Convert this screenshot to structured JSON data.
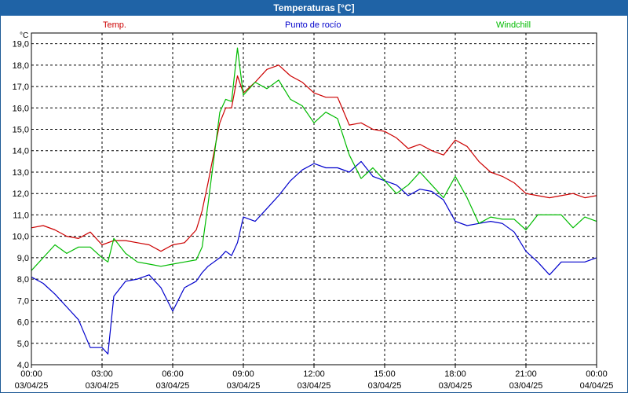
{
  "window": {
    "title": "Temperaturas [°C]"
  },
  "chart_data": {
    "type": "line",
    "title": "Temperaturas [°C]",
    "ylabel": "°C",
    "ylim": [
      4.0,
      19.5
    ],
    "xlim_hours": [
      0,
      24
    ],
    "grid": true,
    "legend_placement": "top",
    "yticks": [
      "4,0",
      "5,0",
      "6,0",
      "7,0",
      "8,0",
      "9,0",
      "10,0",
      "11,0",
      "12,0",
      "13,0",
      "14,0",
      "15,0",
      "16,0",
      "17,0",
      "18,0",
      "19,0"
    ],
    "xticks": [
      {
        "time": "00:00",
        "date": "03/04/25"
      },
      {
        "time": "03:00",
        "date": "03/04/25"
      },
      {
        "time": "06:00",
        "date": "03/04/25"
      },
      {
        "time": "09:00",
        "date": "03/04/25"
      },
      {
        "time": "12:00",
        "date": "03/04/25"
      },
      {
        "time": "15:00",
        "date": "03/04/25"
      },
      {
        "time": "18:00",
        "date": "03/04/25"
      },
      {
        "time": "21:00",
        "date": "03/04/25"
      },
      {
        "time": "00:00",
        "date": "04/04/25"
      }
    ],
    "x": [
      0,
      0.5,
      1,
      1.5,
      2,
      2.5,
      3,
      3.25,
      3.5,
      4,
      4.5,
      5,
      5.5,
      6,
      6.5,
      7,
      7.25,
      7.5,
      8,
      8.25,
      8.5,
      8.75,
      9,
      9.5,
      10,
      10.5,
      11,
      11.5,
      12,
      12.5,
      13,
      13.5,
      14,
      14.5,
      15,
      15.5,
      16,
      16.5,
      17,
      17.5,
      18,
      18.5,
      19,
      19.5,
      20,
      20.5,
      21,
      21.5,
      22,
      22.5,
      23,
      23.5,
      24
    ],
    "series": [
      {
        "name": "Temp.",
        "color": "#cc0000",
        "values": [
          10.4,
          10.5,
          10.3,
          10.0,
          9.9,
          10.2,
          9.6,
          9.7,
          9.8,
          9.8,
          9.7,
          9.6,
          9.3,
          9.6,
          9.7,
          10.3,
          11.2,
          12.5,
          15.3,
          16.0,
          16.0,
          17.5,
          16.7,
          17.2,
          17.8,
          18.0,
          17.5,
          17.2,
          16.7,
          16.5,
          16.5,
          15.2,
          15.3,
          15.0,
          14.9,
          14.6,
          14.1,
          14.3,
          14.0,
          13.8,
          14.5,
          14.2,
          13.5,
          13.0,
          12.8,
          12.5,
          12.0,
          11.9,
          11.8,
          11.9,
          12.0,
          11.8,
          11.9
        ]
      },
      {
        "name": "Punto de rocío",
        "color": "#0000cc",
        "values": [
          8.1,
          7.8,
          7.3,
          6.7,
          6.1,
          4.8,
          4.8,
          4.5,
          7.2,
          7.9,
          8.0,
          8.2,
          7.6,
          6.5,
          7.6,
          7.9,
          8.3,
          8.6,
          9.0,
          9.3,
          9.1,
          9.7,
          10.9,
          10.7,
          11.3,
          11.9,
          12.6,
          13.1,
          13.4,
          13.2,
          13.2,
          13.0,
          13.5,
          12.8,
          12.6,
          12.4,
          11.9,
          12.2,
          12.1,
          11.7,
          10.7,
          10.5,
          10.6,
          10.7,
          10.6,
          10.2,
          9.3,
          8.8,
          8.2,
          8.8,
          8.8,
          8.8,
          9.0
        ]
      },
      {
        "name": "Windchill",
        "color": "#00bb00",
        "values": [
          8.4,
          9.0,
          9.6,
          9.2,
          9.5,
          9.5,
          9.0,
          8.8,
          9.9,
          9.2,
          8.8,
          8.7,
          8.6,
          8.7,
          8.8,
          8.9,
          9.5,
          11.5,
          15.8,
          16.4,
          16.3,
          18.8,
          16.6,
          17.2,
          16.9,
          17.3,
          16.4,
          16.1,
          15.3,
          15.8,
          15.5,
          13.8,
          12.7,
          13.2,
          12.6,
          12.0,
          12.4,
          13.0,
          12.4,
          11.8,
          12.8,
          11.8,
          10.6,
          10.9,
          10.8,
          10.8,
          10.3,
          11.0,
          11.0,
          11.0,
          10.4,
          10.9,
          10.7
        ]
      }
    ]
  }
}
